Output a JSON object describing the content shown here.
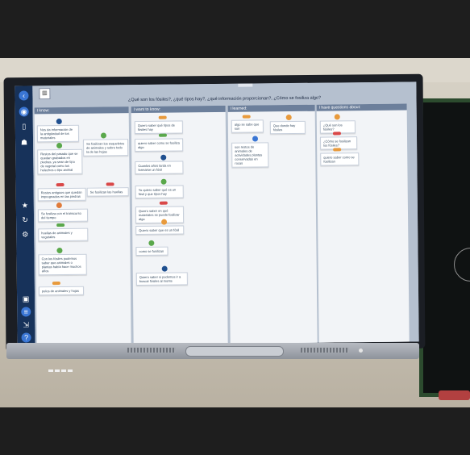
{
  "screen": {
    "title": "¿Qué son los fósiles?, ¿qué tipos hay?, ¿qué información proporcionan?, ¿Cómo se fosiliza algo?",
    "columns": [
      {
        "header": "I know:",
        "cards": [
          "Nos da información de la antigüedad de los materiales",
          "Se fosilizan los esqueletos de animales y sobre todo la de las hojas",
          "Restos del pasado que se quedan grabados en piedras, ya sean de tipo de vegetal como los helechos o tipo animal",
          "Restos antiguos que quedan impregnados en las piedras",
          "Se fosilizan las huellas",
          "Se fosiliza con el transcurso del tiempo",
          "huellas de animales y vegetales",
          "Con los fósiles podemos saber que animales o plantas había hace muchos años",
          "pelos de animales y hojas"
        ]
      },
      {
        "header": "I want to know:",
        "cards": [
          "Quiero saber qué tipos de fósiles hay",
          "quiero saber como se fosiliza algo",
          "Cuantos años tarda en formarse un fósil",
          "Yo quiero saber qué es un fósil y que tipos hay",
          "Quiero saber en qué materiales se puede fosilizar algo",
          "Quiero saber que es un fósil",
          "como se fosilizan",
          "Quiero saber si podemos ir a buscar fósiles al monte"
        ]
      },
      {
        "header": "I learned:",
        "cards": [
          "algo se sabe que son",
          "Que donde hay fósiles",
          "son restos de animales de actividades plantas conservadas en rocas"
        ]
      },
      {
        "header": "I have questions about:",
        "cards": [
          "¿Qué son los fósiles?",
          "¿Cómo se fosilizan los fósiles?",
          "quiero saber como se fosilizan"
        ]
      }
    ]
  },
  "colors": {
    "sidebar": "#17325a",
    "column_header": "#6c7f9b",
    "tag_red": "#d94848",
    "tag_green": "#5aa84b",
    "tag_orange": "#e89a3c",
    "dot_blue": "#1f4f8f"
  }
}
